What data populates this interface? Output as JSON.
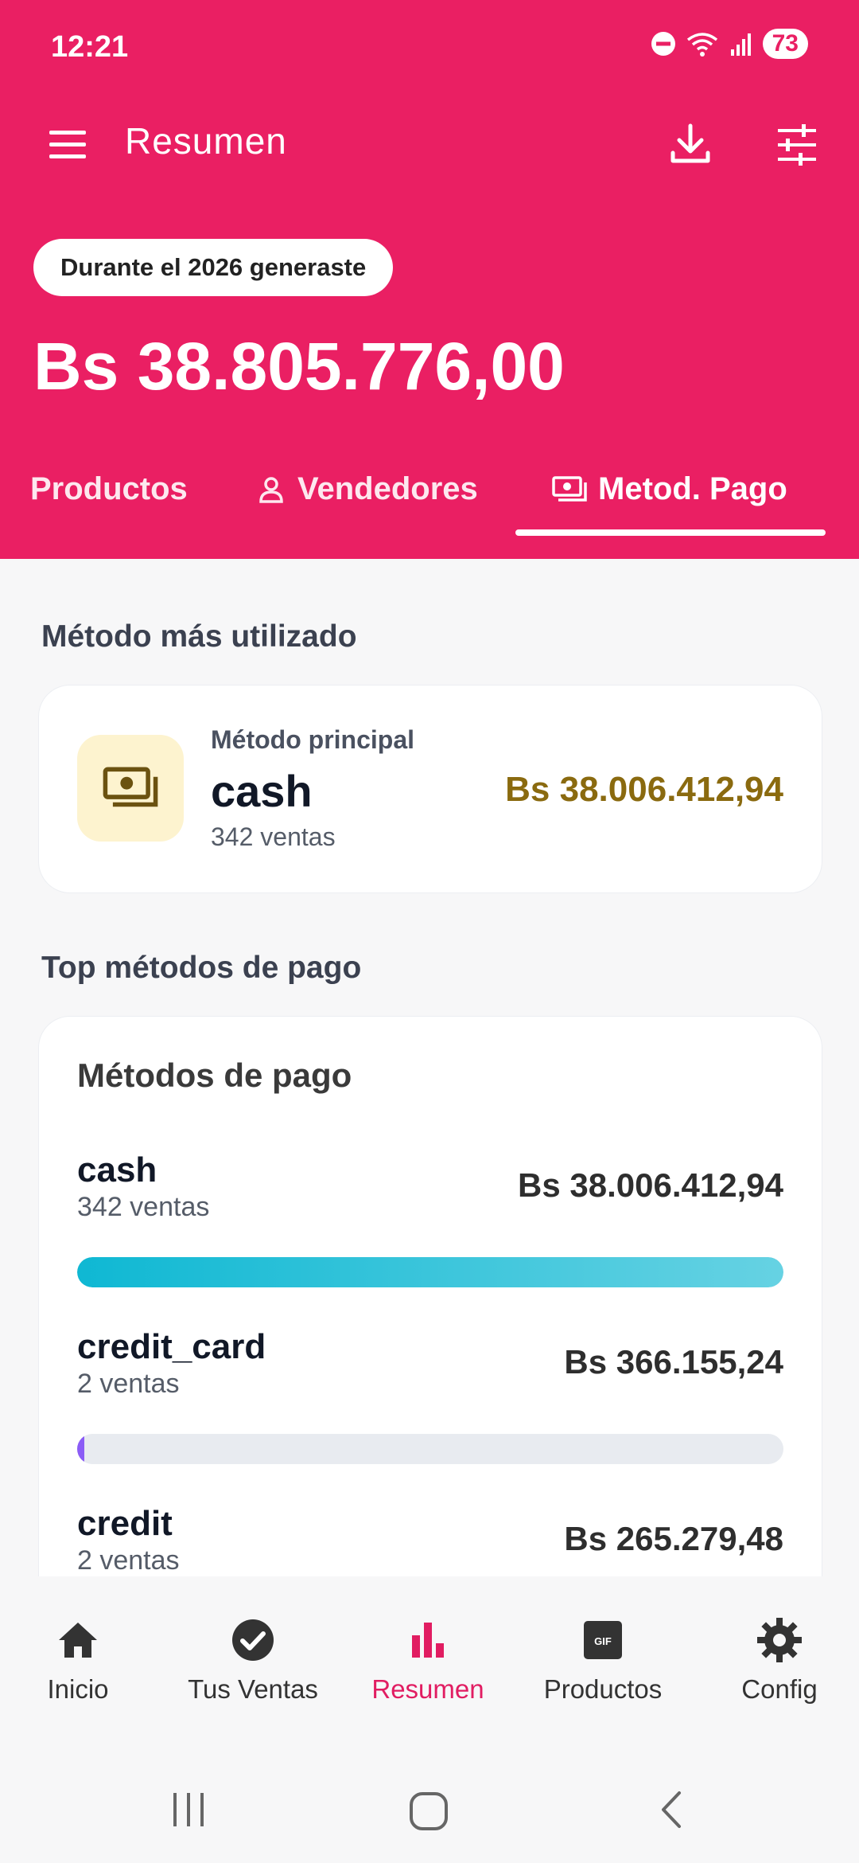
{
  "status_bar": {
    "time": "12:21",
    "battery": "73"
  },
  "toolbar": {
    "title": "Resumen"
  },
  "summary": {
    "period_label": "Durante el 2026 generaste",
    "total": "Bs 38.805.776,00"
  },
  "tabs": [
    {
      "label": "Productos",
      "active": false
    },
    {
      "label": "Vendedores",
      "active": false
    },
    {
      "label": "Metod. Pago",
      "active": true
    }
  ],
  "most_used": {
    "section_title": "Método más utilizado",
    "caption": "Método principal",
    "method": "cash",
    "count": "342 ventas",
    "amount": "Bs 38.006.412,94"
  },
  "top_methods": {
    "section_title": "Top métodos de pago",
    "card_title": "Métodos de pago",
    "rows": [
      {
        "name": "cash",
        "count": "342 ventas",
        "amount": "Bs 38.006.412,94",
        "share": 1.0,
        "color": "#0fb8d3"
      },
      {
        "name": "credit_card",
        "count": "2 ventas",
        "amount": "Bs 366.155,24",
        "share": 0.0096,
        "color": "#8b5cf6"
      },
      {
        "name": "credit",
        "count": "2 ventas",
        "amount": "Bs 265.279,48",
        "share": 0.007,
        "color": "#22c55e"
      }
    ]
  },
  "bottom_nav": [
    {
      "label": "Inicio",
      "icon": "home-icon",
      "active": false
    },
    {
      "label": "Tus Ventas",
      "icon": "check-circle-icon",
      "active": false
    },
    {
      "label": "Resumen",
      "icon": "bar-chart-icon",
      "active": true
    },
    {
      "label": "Productos",
      "icon": "gif-icon",
      "active": false
    },
    {
      "label": "Config",
      "icon": "gear-icon",
      "active": false
    }
  ],
  "colors": {
    "brand": "#ea1f63",
    "accent_amount": "#8a6a0f",
    "active_nav": "#e11d62"
  }
}
